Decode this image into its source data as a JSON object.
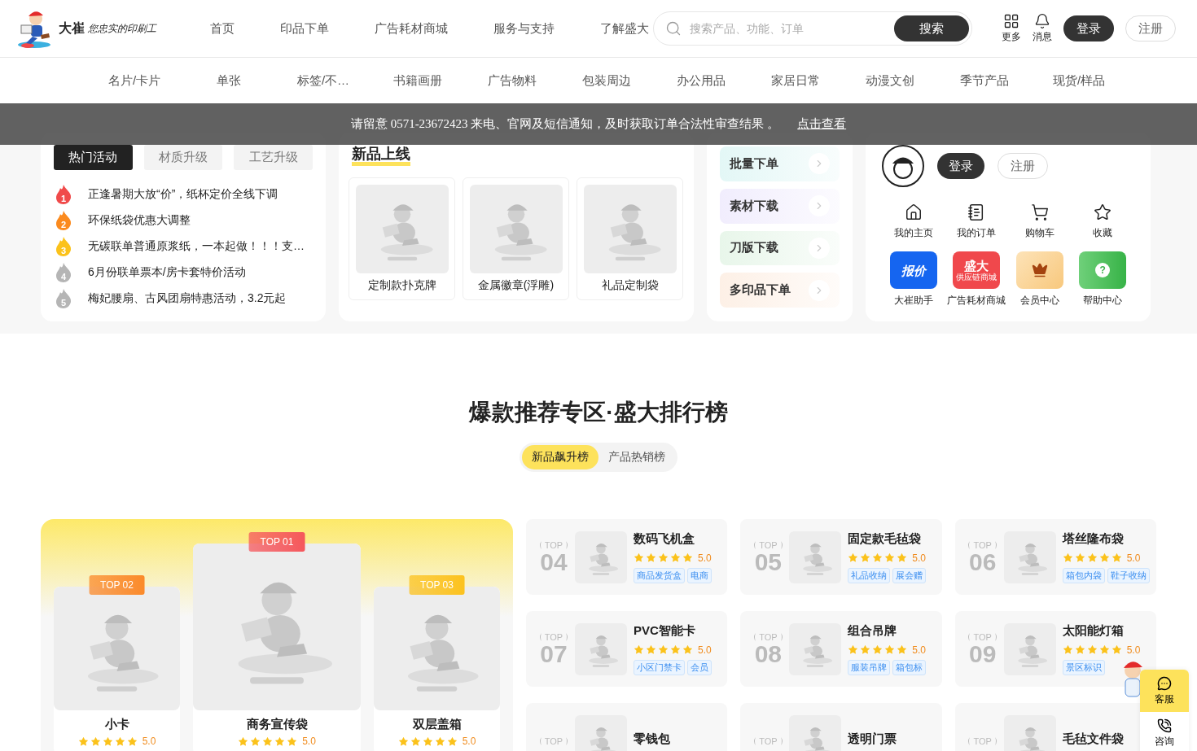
{
  "header": {
    "logo": {
      "brand": "大崔",
      "slogan": "您忠实的印刷工"
    },
    "nav": [
      "首页",
      "印品下单",
      "广告耗材商城",
      "服务与支持",
      "了解盛大"
    ],
    "search": {
      "placeholder": "搜索产品、功能、订单",
      "button": "搜索"
    },
    "actions": [
      {
        "kind": "grid",
        "label": "更多"
      },
      {
        "kind": "bell",
        "label": "消息"
      }
    ],
    "login": "登录",
    "register": "注册"
  },
  "categories": [
    "名片/卡片",
    "单张",
    "标签/不…",
    "书籍画册",
    "广告物料",
    "包装周边",
    "办公用品",
    "家居日常",
    "动漫文创",
    "季节产品",
    "现货/样品"
  ],
  "notice": {
    "text": "请留意 0571-23672423 来电、官网及短信通知，及时获取订单合法性审查结果 。",
    "link": "点击查看"
  },
  "activities": {
    "tabs": [
      {
        "label": "热门活动",
        "selected": true
      },
      {
        "label": "材质升级",
        "selected": false
      },
      {
        "label": "工艺升级",
        "selected": false
      }
    ],
    "items": [
      {
        "rank": "1",
        "color": "#f04a4a",
        "text": "正逢暑期大放“价”，纸杯定价全线下调"
      },
      {
        "rank": "2",
        "color": "#fb8a1e",
        "text": "环保纸袋优惠大调整"
      },
      {
        "rank": "3",
        "color": "#fbc21b",
        "text": "无碳联单普通原浆纸，一本起做！！！支…"
      },
      {
        "rank": "4",
        "color": "#b5b5b5",
        "text": "6月份联单票本/房卡套特价活动"
      },
      {
        "rank": "5",
        "color": "#b5b5b5",
        "text": "梅妃腰扇、古风团扇特惠活动，3.2元起"
      }
    ]
  },
  "new_products": {
    "title": "新品上线",
    "items": [
      {
        "name": "定制款扑克牌"
      },
      {
        "name": "金属徽章(浮雕)"
      },
      {
        "name": "礼品定制袋"
      }
    ]
  },
  "quick_orders": [
    {
      "label": "批量下单",
      "color": "#e3f7f6"
    },
    {
      "label": "素材下载",
      "color": "#f1edfd"
    },
    {
      "label": "刀版下载",
      "color": "#e8f6ea"
    },
    {
      "label": "多印品下单",
      "color": "#fdf0e6"
    }
  ],
  "user": {
    "login": "登录",
    "register": "注册",
    "links": [
      {
        "kind": "home",
        "label": "我的主页"
      },
      {
        "kind": "orders",
        "label": "我的订单"
      },
      {
        "kind": "cart",
        "label": "购物车"
      },
      {
        "kind": "star",
        "label": "收藏"
      }
    ],
    "apps": [
      {
        "kind": "quote",
        "label": "大崔助手",
        "tile": "报价"
      },
      {
        "kind": "mall",
        "label": "广告耗材商城",
        "tile": "盛大",
        "tile_sub": "供应链商城"
      },
      {
        "kind": "member",
        "label": "会员中心"
      },
      {
        "kind": "help",
        "label": "帮助中心",
        "tile": "?"
      }
    ]
  },
  "ranking": {
    "title": "爆款推荐专区·盛大排行榜",
    "tabs": [
      {
        "label": "新品飙升榜",
        "selected": true
      },
      {
        "label": "产品热销榜",
        "selected": false
      }
    ],
    "podium": [
      {
        "badge": "TOP 02",
        "color": "#fb8a2a",
        "name": "小卡",
        "stars": 5,
        "rating": "5.0",
        "big": false
      },
      {
        "badge": "TOP 01",
        "color": "#f5575c",
        "name": "商务宣传袋",
        "stars": 5,
        "rating": "5.0",
        "big": true
      },
      {
        "badge": "TOP 03",
        "color": "#fcc21e",
        "name": "双层盖箱",
        "stars": 5,
        "rating": "5.0",
        "big": false
      }
    ],
    "list": [
      {
        "top": "TOP",
        "rank": "04",
        "name": "数码飞机盒",
        "stars": 5,
        "rating": "5.0",
        "tags": [
          "商品发货盒",
          "电商"
        ]
      },
      {
        "top": "TOP",
        "rank": "05",
        "name": "固定款毛毡袋",
        "stars": 5,
        "rating": "5.0",
        "tags": [
          "礼品收纳",
          "展会赠"
        ]
      },
      {
        "top": "TOP",
        "rank": "06",
        "name": "塔丝隆布袋",
        "stars": 5,
        "rating": "5.0",
        "tags": [
          "箱包内袋",
          "鞋子收纳"
        ]
      },
      {
        "top": "TOP",
        "rank": "07",
        "name": "PVC智能卡",
        "stars": 5,
        "rating": "5.0",
        "tags": [
          "小区门禁卡",
          "会员"
        ]
      },
      {
        "top": "TOP",
        "rank": "08",
        "name": "组合吊牌",
        "stars": 5,
        "rating": "5.0",
        "tags": [
          "服装吊牌",
          "箱包标"
        ]
      },
      {
        "top": "TOP",
        "rank": "09",
        "name": "太阳能灯箱",
        "stars": 5,
        "rating": "5.0",
        "tags": [
          "景区标识"
        ]
      },
      {
        "top": "TOP",
        "name": "零钱包"
      },
      {
        "top": "TOP",
        "name": "透明门票"
      },
      {
        "top": "TOP",
        "name": "毛毡文件袋"
      }
    ]
  },
  "side": [
    {
      "kind": "chat",
      "label": "客服",
      "selected": true
    },
    {
      "kind": "phone",
      "label": "咨询",
      "selected": false
    }
  ]
}
